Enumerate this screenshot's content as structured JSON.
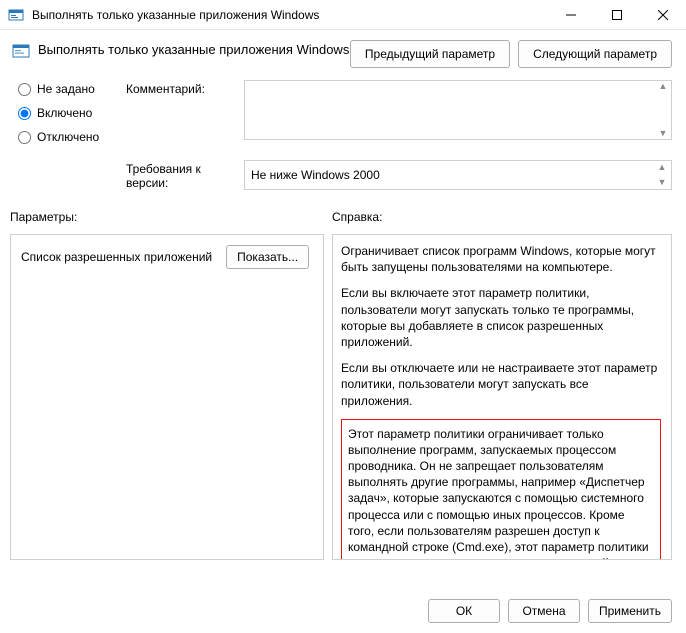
{
  "window": {
    "title": "Выполнять только указанные приложения Windows"
  },
  "header": {
    "title": "Выполнять только указанные приложения Windows",
    "prev": "Предыдущий параметр",
    "next": "Следующий параметр"
  },
  "state": {
    "not_configured": "Не задано",
    "enabled": "Включено",
    "disabled": "Отключено",
    "selected": "enabled"
  },
  "labels": {
    "comment": "Комментарий:",
    "requirements": "Требования к версии:",
    "params": "Параметры:",
    "help": "Справка:"
  },
  "fields": {
    "comment": "",
    "requirements": "Не ниже Windows 2000"
  },
  "params_panel": {
    "allowed_label": "Список разрешенных приложений",
    "show_button": "Показать..."
  },
  "help_panel": {
    "p1": "Ограничивает список программ Windows, которые могут быть запущены пользователями на компьютере.",
    "p2": "Если вы включаете этот параметр политики, пользователи могут запускать только те программы, которые вы добавляете в список разрешенных приложений.",
    "p3": "Если вы отключаете или не настраиваете этот параметр политики, пользователи могут запускать все приложения.",
    "note": "Этот параметр политики ограничивает только выполнение программ, запускаемых процессом проводника.  Он не запрещает пользователям выполнять другие программы, например «Диспетчер задач», которые запускаются с помощью системного процесса или с помощью иных процессов.  Кроме того, если пользователям разрешен доступ к командной строке (Cmd.exe), этот параметр политики не запрещает им запускать из окна командной строки даже те программы, которые им не разрешено запускать с помощью проводника."
  },
  "footer": {
    "ok": "ОК",
    "cancel": "Отмена",
    "apply": "Применить"
  }
}
